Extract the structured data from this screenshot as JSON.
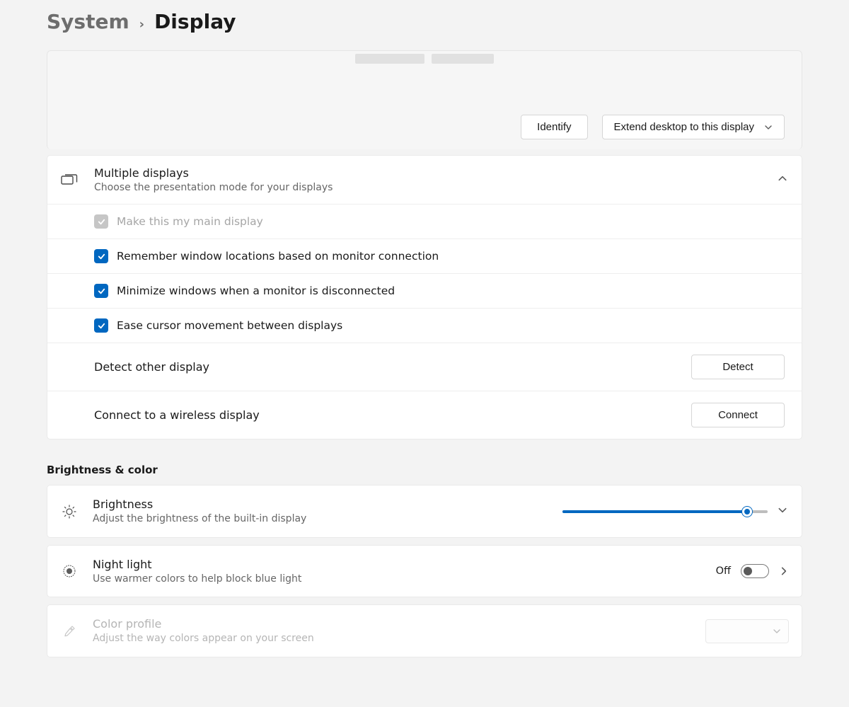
{
  "breadcrumb": {
    "parent": "System",
    "current": "Display"
  },
  "arrangement": {
    "identify_button": "Identify",
    "mode_dropdown": "Extend desktop to this display"
  },
  "multiple_displays": {
    "title": "Multiple displays",
    "subtitle": "Choose the presentation mode for your displays",
    "options": {
      "main_display": {
        "label": "Make this my main display",
        "checked": true,
        "disabled": true
      },
      "remember_locations": {
        "label": "Remember window locations based on monitor connection",
        "checked": true
      },
      "minimize_disconnect": {
        "label": "Minimize windows when a monitor is disconnected",
        "checked": true
      },
      "ease_cursor": {
        "label": "Ease cursor movement between displays",
        "checked": true
      }
    },
    "detect": {
      "label": "Detect other display",
      "button": "Detect"
    },
    "wireless": {
      "label": "Connect to a wireless display",
      "button": "Connect"
    }
  },
  "section_heading": "Brightness & color",
  "brightness": {
    "title": "Brightness",
    "subtitle": "Adjust the brightness of the built-in display",
    "value_percent": 90
  },
  "night_light": {
    "title": "Night light",
    "subtitle": "Use warmer colors to help block blue light",
    "state_label": "Off",
    "on": false
  },
  "color_profile": {
    "title": "Color profile",
    "subtitle": "Adjust the way colors appear on your screen"
  }
}
